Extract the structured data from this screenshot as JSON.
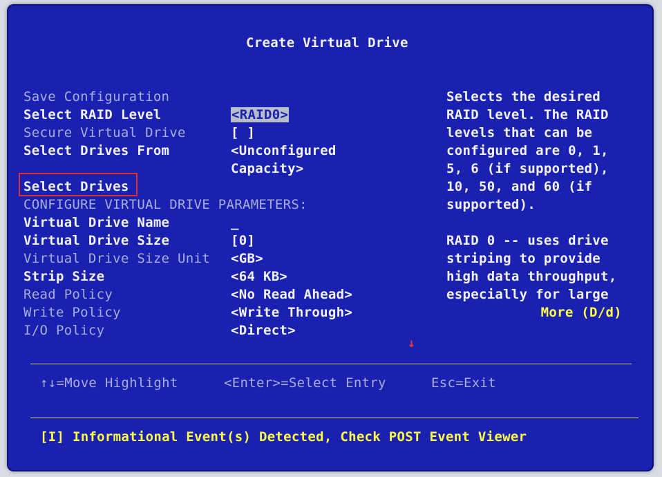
{
  "title": "Create Virtual Drive",
  "settings": [
    {
      "label": "Save Configuration",
      "value": "",
      "enabled": false
    },
    {
      "label": "Select RAID Level",
      "value": "<RAID0>",
      "enabled": true,
      "selected": true
    },
    {
      "label": "Secure Virtual Drive",
      "value": "[ ]",
      "enabled": false
    },
    {
      "label": "Select Drives From",
      "value": "<Unconfigured",
      "value2": "Capacity>",
      "enabled": true
    },
    {
      "label": "Select Drives",
      "value": "",
      "enabled": true,
      "highlighted": true
    },
    {
      "label": "CONFIGURE VIRTUAL DRIVE PARAMETERS:",
      "value": "",
      "enabled": false
    },
    {
      "label": "Virtual Drive Name",
      "value": "_",
      "enabled": true
    },
    {
      "label": "Virtual Drive Size",
      "value": "[0]",
      "enabled": true
    },
    {
      "label": "Virtual Drive Size Unit",
      "value": "<GB>",
      "enabled": false
    },
    {
      "label": "Strip Size",
      "value": "<64 KB>",
      "enabled": true
    },
    {
      "label": "Read Policy",
      "value": "<No Read Ahead>",
      "enabled": false
    },
    {
      "label": "Write Policy",
      "value": "<Write Through>",
      "enabled": false
    },
    {
      "label": "I/O Policy",
      "value": "<Direct>",
      "enabled": false
    }
  ],
  "help": {
    "lines": [
      "Selects the desired",
      "RAID level. The RAID",
      "levels that can be",
      "configured are 0, 1,",
      "5, 6 (if supported),",
      "10, 50, and 60 (if",
      "supported).",
      "",
      "RAID 0 -- uses drive",
      "striping to provide",
      "high data throughput,",
      "especially for large"
    ],
    "more": "More (D/d)"
  },
  "footer": {
    "move": "↑↓=Move Highlight",
    "enter": "<Enter>=Select Entry",
    "esc": "Esc=Exit"
  },
  "status": "[I] Informational Event(s) Detected, Check POST Event Viewer",
  "colors": {
    "background": "#1a20b0",
    "highlight_box": "#e03030",
    "status_text": "#ffff44"
  }
}
